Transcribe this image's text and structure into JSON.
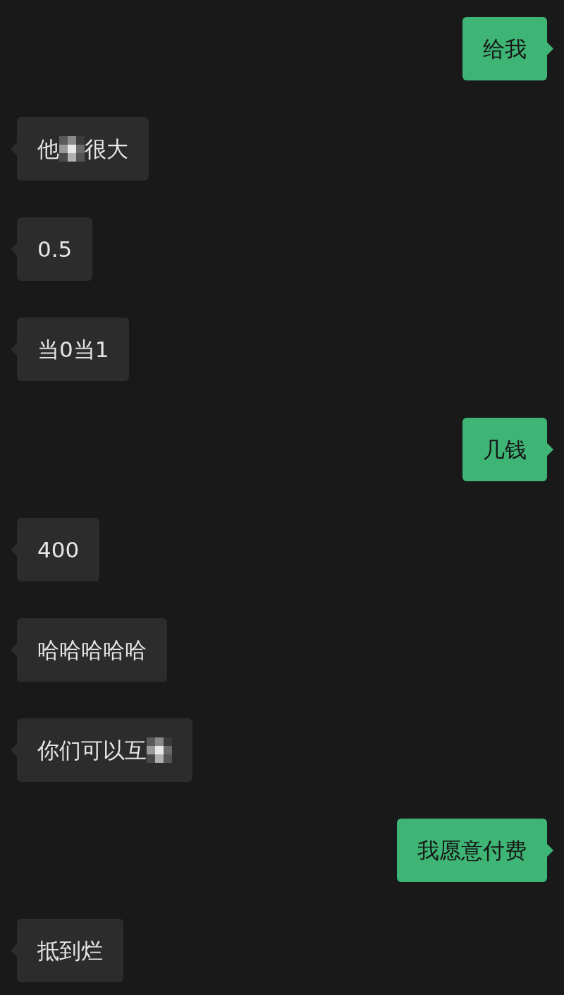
{
  "messages": [
    {
      "kind": "outgoing",
      "segments": [
        "给我"
      ],
      "redacted": false
    },
    {
      "kind": "incoming",
      "segments": [
        "他",
        "很大"
      ],
      "redacted": true
    },
    {
      "kind": "incoming",
      "segments": [
        "0.5"
      ],
      "redacted": false
    },
    {
      "kind": "incoming",
      "segments": [
        "当0当1"
      ],
      "redacted": false
    },
    {
      "kind": "outgoing",
      "segments": [
        "几钱"
      ],
      "redacted": false
    },
    {
      "kind": "incoming",
      "segments": [
        "400"
      ],
      "redacted": false
    },
    {
      "kind": "incoming",
      "segments": [
        "哈哈哈哈哈"
      ],
      "redacted": false
    },
    {
      "kind": "incoming",
      "segments": [
        "你们可以互"
      ],
      "redacted": true
    },
    {
      "kind": "outgoing",
      "segments": [
        "我愿意付费"
      ],
      "redacted": false
    },
    {
      "kind": "incoming",
      "segments": [
        "抵到烂"
      ],
      "redacted": false
    }
  ]
}
